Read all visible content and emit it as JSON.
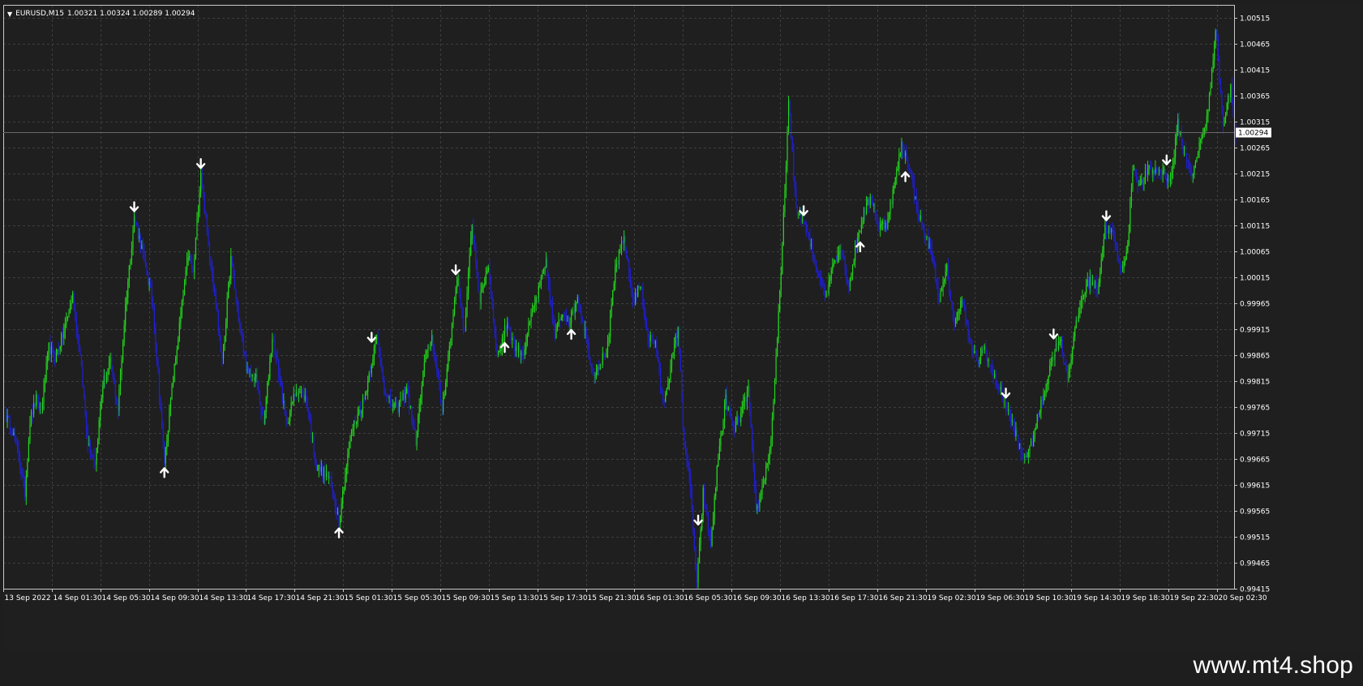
{
  "header": {
    "symbol_tf": "EURUSD,M15",
    "ohlc": "1.00321 1.00324 1.00289 1.00294"
  },
  "watermark": "www.mt4.shop",
  "colors": {
    "background": "#1e1e1e",
    "grid": "#3e3e3e",
    "bull": "#22d61c",
    "bear": "#1f1fd8",
    "axis": "#c8c8c8",
    "arrow": "#ffffff"
  },
  "chart_data": {
    "type": "candlestick",
    "symbol": "EURUSD",
    "timeframe": "M15",
    "grid": true,
    "ylim": [
      0.99415,
      1.0054
    ],
    "y_ticks": [
      "1.00515",
      "1.00465",
      "1.00415",
      "1.00365",
      "1.00315",
      "1.00265",
      "1.00215",
      "1.00165",
      "1.00115",
      "1.00065",
      "1.00015",
      "0.99965",
      "0.99915",
      "0.99865",
      "0.99815",
      "0.99765",
      "0.99715",
      "0.99665",
      "0.99615",
      "0.99565",
      "0.99515",
      "0.99465",
      "0.99415"
    ],
    "x_ticks": [
      "13 Sep 2022",
      "14 Sep 01:30",
      "14 Sep 05:30",
      "14 Sep 09:30",
      "14 Sep 13:30",
      "14 Sep 17:30",
      "14 Sep 21:30",
      "15 Sep 01:30",
      "15 Sep 05:30",
      "15 Sep 09:30",
      "15 Sep 13:30",
      "15 Sep 17:30",
      "15 Sep 21:30",
      "16 Sep 01:30",
      "16 Sep 05:30",
      "16 Sep 09:30",
      "16 Sep 13:30",
      "16 Sep 17:30",
      "16 Sep 21:30",
      "19 Sep 02:30",
      "19 Sep 06:30",
      "19 Sep 10:30",
      "19 Sep 14:30",
      "19 Sep 18:30",
      "19 Sep 22:30",
      "20 Sep 02:30"
    ],
    "current_price": "1.00294",
    "path": [
      [
        0,
        0.9975
      ],
      [
        6,
        0.9972
      ],
      [
        11,
        0.9967
      ],
      [
        16,
        0.996
      ],
      [
        20,
        0.9974
      ],
      [
        25,
        0.9978
      ],
      [
        29,
        0.9976
      ],
      [
        35,
        0.9988
      ],
      [
        40,
        0.9986
      ],
      [
        47,
        0.9991
      ],
      [
        54,
        0.9998
      ],
      [
        60,
        0.9986
      ],
      [
        66,
        0.997
      ],
      [
        72,
        0.9966
      ],
      [
        78,
        0.9981
      ],
      [
        84,
        0.9985
      ],
      [
        90,
        0.9976
      ],
      [
        96,
        0.9996
      ],
      [
        103,
        1.0013
      ],
      [
        110,
        1.0006
      ],
      [
        118,
        0.9996
      ],
      [
        127,
        0.9966
      ],
      [
        133,
        0.998
      ],
      [
        140,
        0.9994
      ],
      [
        146,
        1.0006
      ],
      [
        150,
        1.0002
      ],
      [
        156,
        1.0022
      ],
      [
        162,
        1.0008
      ],
      [
        168,
        0.9997
      ],
      [
        173,
        0.9985
      ],
      [
        180,
        1.0005
      ],
      [
        187,
        0.9992
      ],
      [
        193,
        0.9983
      ],
      [
        200,
        0.9982
      ],
      [
        206,
        0.9973
      ],
      [
        213,
        0.999
      ],
      [
        219,
        0.9982
      ],
      [
        224,
        0.9973
      ],
      [
        232,
        0.998
      ],
      [
        240,
        0.9978
      ],
      [
        248,
        0.9965
      ],
      [
        258,
        0.9963
      ],
      [
        266,
        0.9955
      ],
      [
        276,
        0.9972
      ],
      [
        286,
        0.9978
      ],
      [
        296,
        0.999
      ],
      [
        304,
        0.9978
      ],
      [
        312,
        0.9976
      ],
      [
        320,
        0.998
      ],
      [
        327,
        0.997
      ],
      [
        334,
        0.9985
      ],
      [
        340,
        0.999
      ],
      [
        348,
        0.9976
      ],
      [
        355,
        0.999
      ],
      [
        360,
        1.0002
      ],
      [
        366,
        0.9991
      ],
      [
        372,
        1.0012
      ],
      [
        378,
        0.9997
      ],
      [
        385,
        1.0004
      ],
      [
        392,
        0.9986
      ],
      [
        400,
        0.9993
      ],
      [
        406,
        0.9988
      ],
      [
        413,
        0.9987
      ],
      [
        419,
        0.9994
      ],
      [
        425,
        0.9999
      ],
      [
        431,
        1.0004
      ],
      [
        438,
        0.999
      ],
      [
        444,
        0.9995
      ],
      [
        450,
        0.9993
      ],
      [
        456,
        0.9998
      ],
      [
        462,
        0.9991
      ],
      [
        468,
        0.9983
      ],
      [
        474,
        0.9985
      ],
      [
        480,
        0.9988
      ],
      [
        486,
        1.0003
      ],
      [
        493,
        1.0009
      ],
      [
        500,
        0.9997
      ],
      [
        506,
        1.0
      ],
      [
        512,
        0.999
      ],
      [
        518,
        0.9989
      ],
      [
        524,
        0.9977
      ],
      [
        530,
        0.9984
      ],
      [
        536,
        0.9992
      ],
      [
        540,
        0.9973
      ],
      [
        546,
        0.996
      ],
      [
        551,
        0.9942
      ],
      [
        556,
        0.996
      ],
      [
        562,
        0.995
      ],
      [
        568,
        0.9967
      ],
      [
        574,
        0.9978
      ],
      [
        580,
        0.9972
      ],
      [
        586,
        0.9975
      ],
      [
        592,
        0.998
      ],
      [
        598,
        0.9956
      ],
      [
        604,
        0.9962
      ],
      [
        610,
        0.997
      ],
      [
        618,
        1.0002
      ],
      [
        624,
        1.0035
      ],
      [
        630,
        1.0015
      ],
      [
        636,
        1.0012
      ],
      [
        642,
        1.0007
      ],
      [
        648,
        1.0002
      ],
      [
        654,
        0.9998
      ],
      [
        660,
        1.0005
      ],
      [
        666,
        1.0007
      ],
      [
        672,
        1.0
      ],
      [
        678,
        1.0008
      ],
      [
        684,
        1.0014
      ],
      [
        690,
        1.0017
      ],
      [
        696,
        1.0011
      ],
      [
        702,
        1.0012
      ],
      [
        708,
        1.0019
      ],
      [
        714,
        1.0027
      ],
      [
        720,
        1.0023
      ],
      [
        726,
        1.0015
      ],
      [
        732,
        1.001
      ],
      [
        738,
        1.0006
      ],
      [
        744,
        0.9997
      ],
      [
        750,
        1.0003
      ],
      [
        756,
        0.9992
      ],
      [
        762,
        0.9998
      ],
      [
        768,
        0.9989
      ],
      [
        774,
        0.9985
      ],
      [
        780,
        0.9988
      ],
      [
        786,
        0.9983
      ],
      [
        792,
        0.998
      ],
      [
        798,
        0.9976
      ],
      [
        804,
        0.9972
      ],
      [
        810,
        0.9967
      ],
      [
        816,
        0.9968
      ],
      [
        822,
        0.9974
      ],
      [
        828,
        0.998
      ],
      [
        834,
        0.9986
      ],
      [
        840,
        0.999
      ],
      [
        846,
        0.9982
      ],
      [
        852,
        0.9991
      ],
      [
        858,
        0.9998
      ],
      [
        864,
        1.0001
      ],
      [
        870,
        0.9999
      ],
      [
        876,
        1.0011
      ],
      [
        882,
        1.001
      ],
      [
        888,
        1.0003
      ],
      [
        894,
        1.0007
      ],
      [
        898,
        1.0023
      ],
      [
        904,
        1.0019
      ],
      [
        910,
        1.0022
      ],
      [
        916,
        1.0022
      ],
      [
        922,
        1.0022
      ],
      [
        928,
        1.002
      ],
      [
        934,
        1.0031
      ],
      [
        940,
        1.0025
      ],
      [
        946,
        1.0021
      ],
      [
        952,
        1.0028
      ],
      [
        958,
        1.0033
      ],
      [
        964,
        1.005
      ],
      [
        970,
        1.0031
      ],
      [
        976,
        1.0038
      ],
      [
        980,
        1.0029
      ]
    ],
    "markers": [
      {
        "type": "sell",
        "i": 103
      },
      {
        "type": "buy",
        "i": 127
      },
      {
        "type": "sell",
        "i": 156
      },
      {
        "type": "buy",
        "i": 266
      },
      {
        "type": "sell",
        "i": 292
      },
      {
        "type": "sell",
        "i": 359
      },
      {
        "type": "buy",
        "i": 398
      },
      {
        "type": "buy",
        "i": 451
      },
      {
        "type": "sell",
        "i": 552
      },
      {
        "type": "sell",
        "i": 636
      },
      {
        "type": "buy",
        "i": 681
      },
      {
        "type": "buy",
        "i": 717
      },
      {
        "type": "sell",
        "i": 797
      },
      {
        "type": "sell",
        "i": 835
      },
      {
        "type": "sell",
        "i": 877
      },
      {
        "type": "sell",
        "i": 925
      }
    ]
  }
}
